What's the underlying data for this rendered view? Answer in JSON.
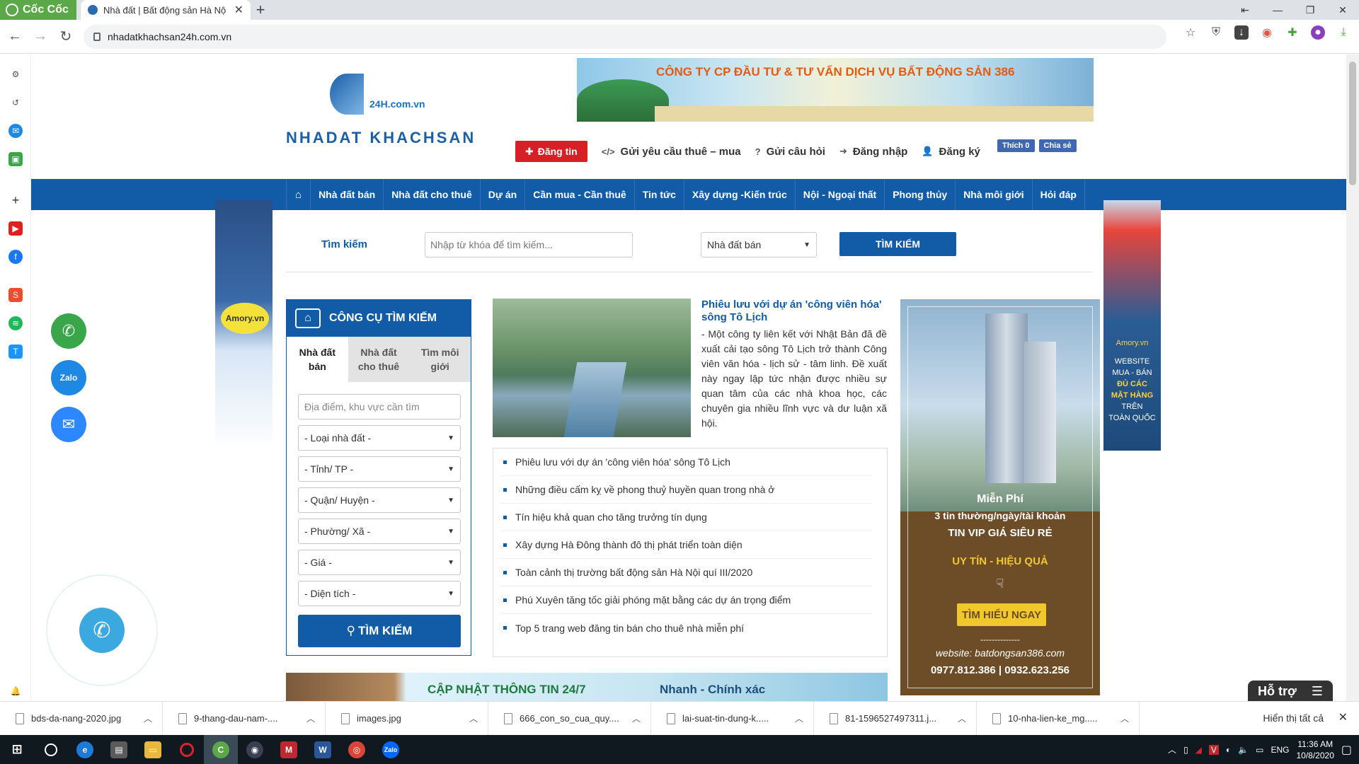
{
  "browser": {
    "brand": "Cốc Cốc",
    "tab_title": "Nhà đất | Bất động sản Hà Nộ",
    "url": "nhadatkhachsan24h.com.vn"
  },
  "site": {
    "logo_suffix": "24H.com.vn",
    "logo_name": "NHADAT KHACHSAN",
    "banner_text": "CÔNG TY CP ĐẦU TƯ & TƯ VẤN DỊCH VỤ BẤT ĐỘNG SẢN 386",
    "actions": {
      "post": "Đăng tin",
      "request": "Gửi yêu cầu thuê – mua",
      "question": "Gửi câu hỏi",
      "login": "Đăng nhập",
      "register": "Đăng ký"
    },
    "fb": {
      "like": "Thích 0",
      "share": "Chia sẻ"
    },
    "nav": [
      "Nhà đất bán",
      "Nhà đất cho thuê",
      "Dự án",
      "Cần mua - Cần thuê",
      "Tin tức",
      "Xây dựng -Kiến trúc",
      "Nội - Ngoại thất",
      "Phong thủy",
      "Nhà môi giới",
      "Hỏi đáp"
    ],
    "ad_left": "Amory.vn",
    "ad_right": {
      "brand": "Amory.vn",
      "l1": "WEBSITE",
      "l2": "MUA - BÁN",
      "l3": "ĐỦ CÁC",
      "l4": "MẶT HÀNG",
      "l5": "TRÊN",
      "l6": "TOÀN QUỐC"
    }
  },
  "search": {
    "label": "Tìm kiếm",
    "placeholder": "Nhập từ khóa để tìm kiếm...",
    "category": "Nhà đất bán",
    "button": "TÌM KIẾM"
  },
  "tool": {
    "title": "CÔNG CỤ TÌM KIẾM",
    "tabs": [
      "Nhà đất bán",
      "Nhà đất cho thuê",
      "Tìm môi giới"
    ],
    "location_placeholder": "Địa điểm, khu vực cần tìm",
    "selects": [
      "- Loại nhà đất -",
      "- Tỉnh/ TP -",
      "- Quận/ Huyện -",
      "- Phường/ Xã -",
      "- Giá -",
      "- Diện tích -"
    ],
    "button": "TÌM KIẾM"
  },
  "news": {
    "title": "Phiêu lưu với dự án 'công viên hóa' sông Tô Lịch",
    "summary": "- Một công ty liên kết với Nhật Bản đã đề xuất cải tạo sông Tô Lịch trở thành Công viên văn hóa - lịch sử - tâm linh. Đề xuất này ngay lập tức nhận được nhiều sự quan tâm của các nhà khoa học, các chuyên gia nhiều lĩnh vực và dư luận xã hội.",
    "list": [
      "Phiêu lưu với dự án 'công viên hóa' sông Tô Lịch",
      "Những điều cấm kỵ về phong thuỷ huyền quan trong nhà ở",
      "Tín hiệu khả quan cho tăng trưởng tín dụng",
      "Xây dựng Hà Đông thành đô thị phát triển toàn diện",
      "Toàn cảnh thị trường bất động sản Hà Nội quí III/2020",
      "Phú Xuyên tăng tốc giải phóng mặt bằng các dự án trọng điểm",
      "Top 5 trang web đăng tin bán cho thuê nhà miễn phí"
    ],
    "bottom_banner": "CẬP NHẬT THÔNG TIN 24/7",
    "bottom_banner2": "Nhanh - Chính xác"
  },
  "ad_big": {
    "free": "Miễn Phí",
    "line1": "3 tin thường/ngày/tài khoản",
    "line2": "TIN VIP GIÁ SIÊU RẺ",
    "line3": "UY TÍN - HIỆU QUẢ",
    "button": "TÌM HIỂU NGAY",
    "dash": "--------------",
    "website": "website: batdongsan386.com",
    "phones": "0977.812.386 | 0932.623.256"
  },
  "support": "Hỗ trợ",
  "downloads": {
    "items": [
      "bds-da-nang-2020.jpg",
      "9-thang-dau-nam-....",
      "images.jpg",
      "666_con_so_cua_quy....",
      "lai-suat-tin-dung-k.....",
      "81-1596527497311.j...",
      "10-nha-lien-ke_mg....."
    ],
    "show_all": "Hiển thị tất cả"
  },
  "taskbar": {
    "lang": "ENG",
    "time": "11:36 AM",
    "date": "10/8/2020"
  },
  "colors": {
    "primary": "#115ba7",
    "post_button": "#d61f26",
    "ad_brown": "#6d4c28"
  }
}
